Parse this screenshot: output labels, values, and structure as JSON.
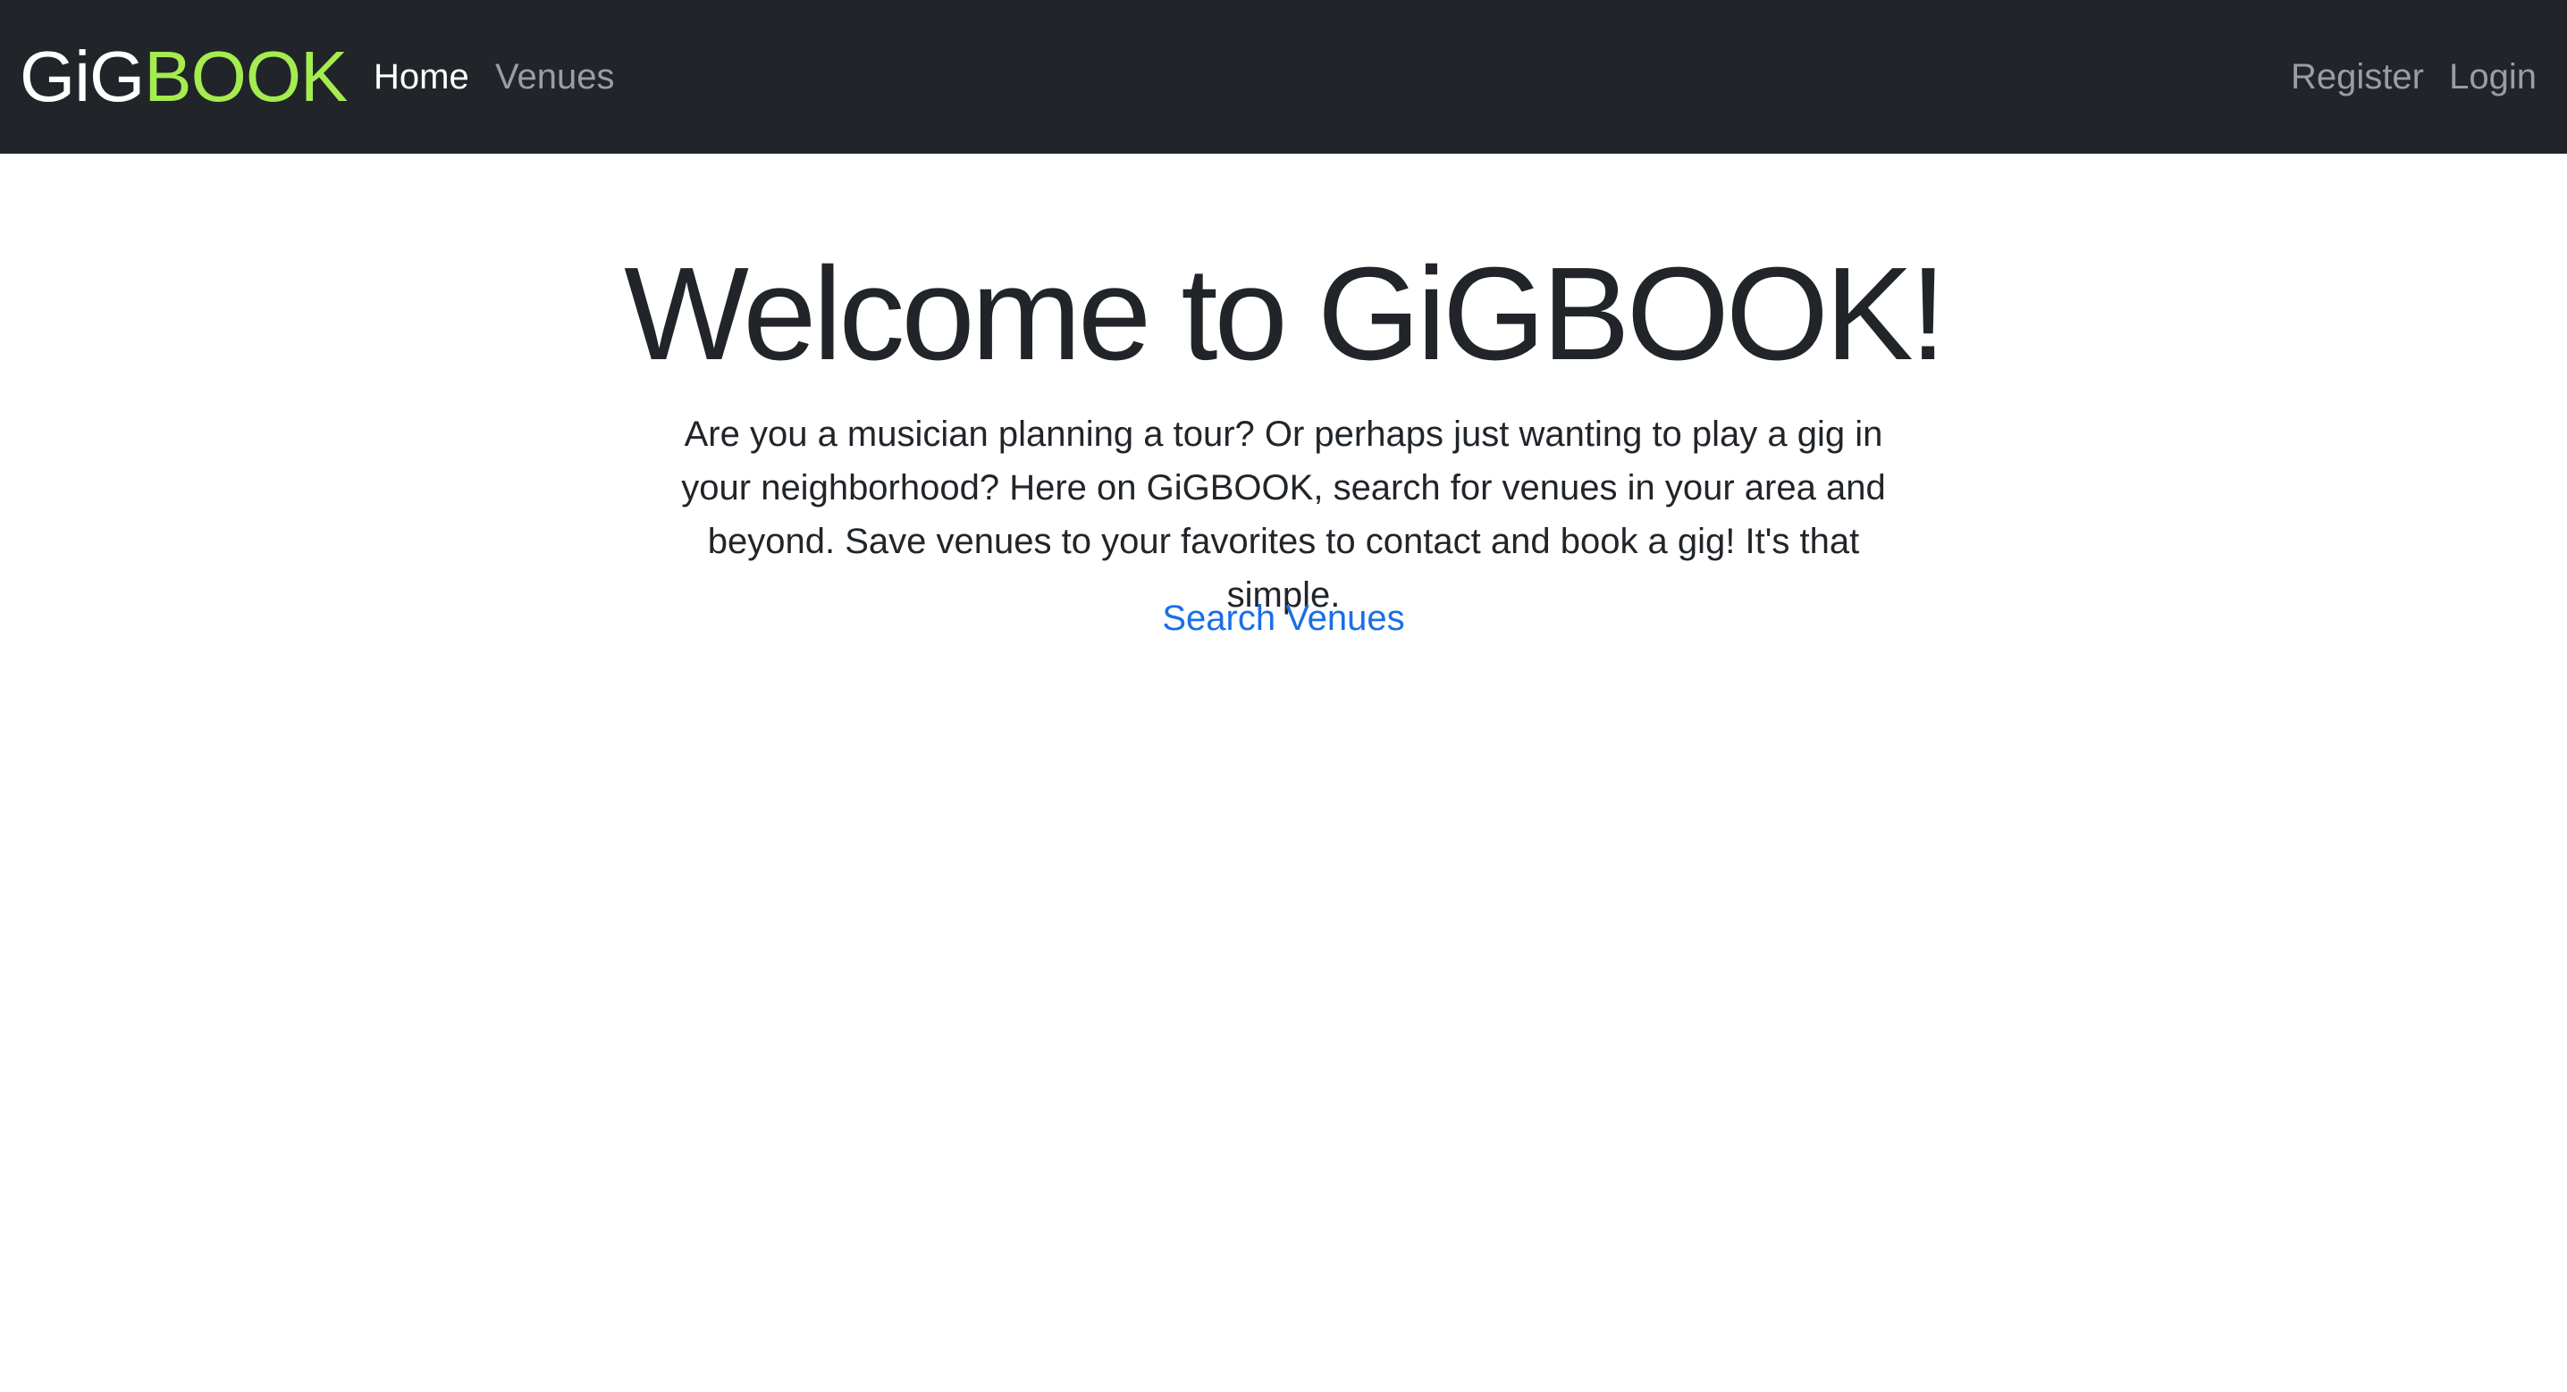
{
  "navbar": {
    "brand_part_a": "GiG",
    "brand_part_b": "BOOK",
    "left_links": [
      "Home",
      "Venues"
    ],
    "right_links": [
      "Register",
      "Login"
    ],
    "active_link": "Home"
  },
  "hero": {
    "title": "Welcome to GiGBOOK!",
    "description": "Are you a musician planning a tour? Or perhaps just wanting to play a gig in your neighborhood? Here on GiGBOOK, search for venues in your area and beyond. Save venues to your favorites to contact and book a gig! It's that simple.",
    "cta_label": "Search Venues"
  },
  "colors": {
    "navbar_bg": "#212529",
    "brand_accent": "#a4ec4f",
    "link_blue": "#1a6ee6",
    "nav_muted": "#9a9da1"
  }
}
